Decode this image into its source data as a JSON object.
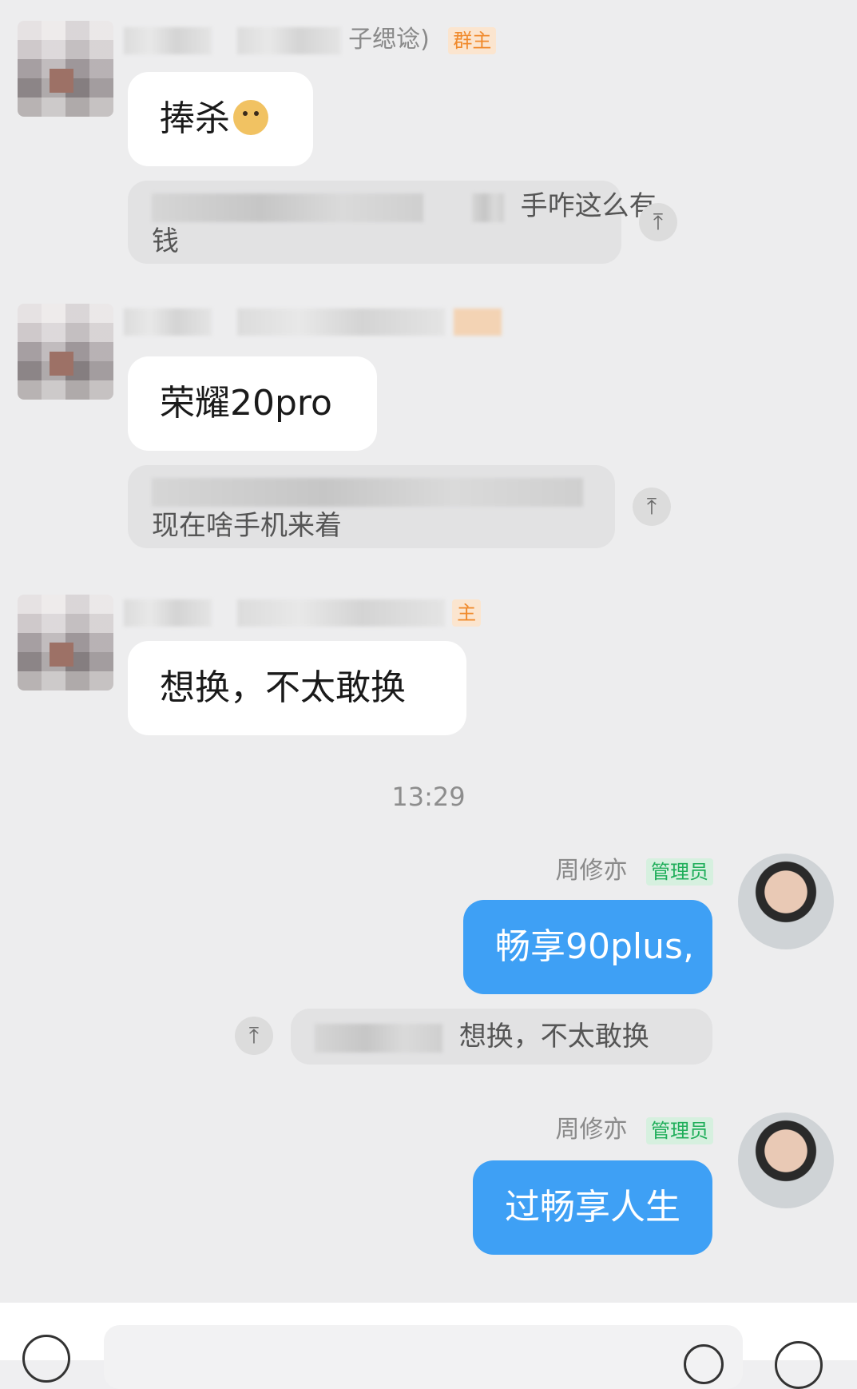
{
  "messages": [
    {
      "sender_suffix": "子缌谂)",
      "role_tag": "群主",
      "text": "捧杀",
      "emoji": "doge-emoji",
      "quote_text_line1": "手咋这么有",
      "quote_text_line2": "钱"
    },
    {
      "role_tag": "",
      "text": "荣耀20pro",
      "quote_text": "现在啥手机来着"
    },
    {
      "role_tag": "主",
      "text": "想换，不太敢换"
    }
  ],
  "timestamp": "13:29",
  "my_messages": [
    {
      "sender": "周修亦",
      "role_tag": "管理员",
      "text": "畅享90plus,",
      "quote_text": "想换，不太敢换"
    },
    {
      "sender": "周修亦",
      "role_tag": "管理员",
      "text": "过畅享人生"
    }
  ],
  "colors": {
    "background": "#ededee",
    "bubble_white": "#ffffff",
    "bubble_blue": "#3ea0f5",
    "owner_tag": "#f08a2c",
    "admin_tag": "#1fae5a"
  },
  "icons": {
    "jump_to_quote": "arrow-up-to-line-icon",
    "voice": "voice-icon",
    "emoji": "emoji-icon",
    "plus": "plus-icon"
  }
}
